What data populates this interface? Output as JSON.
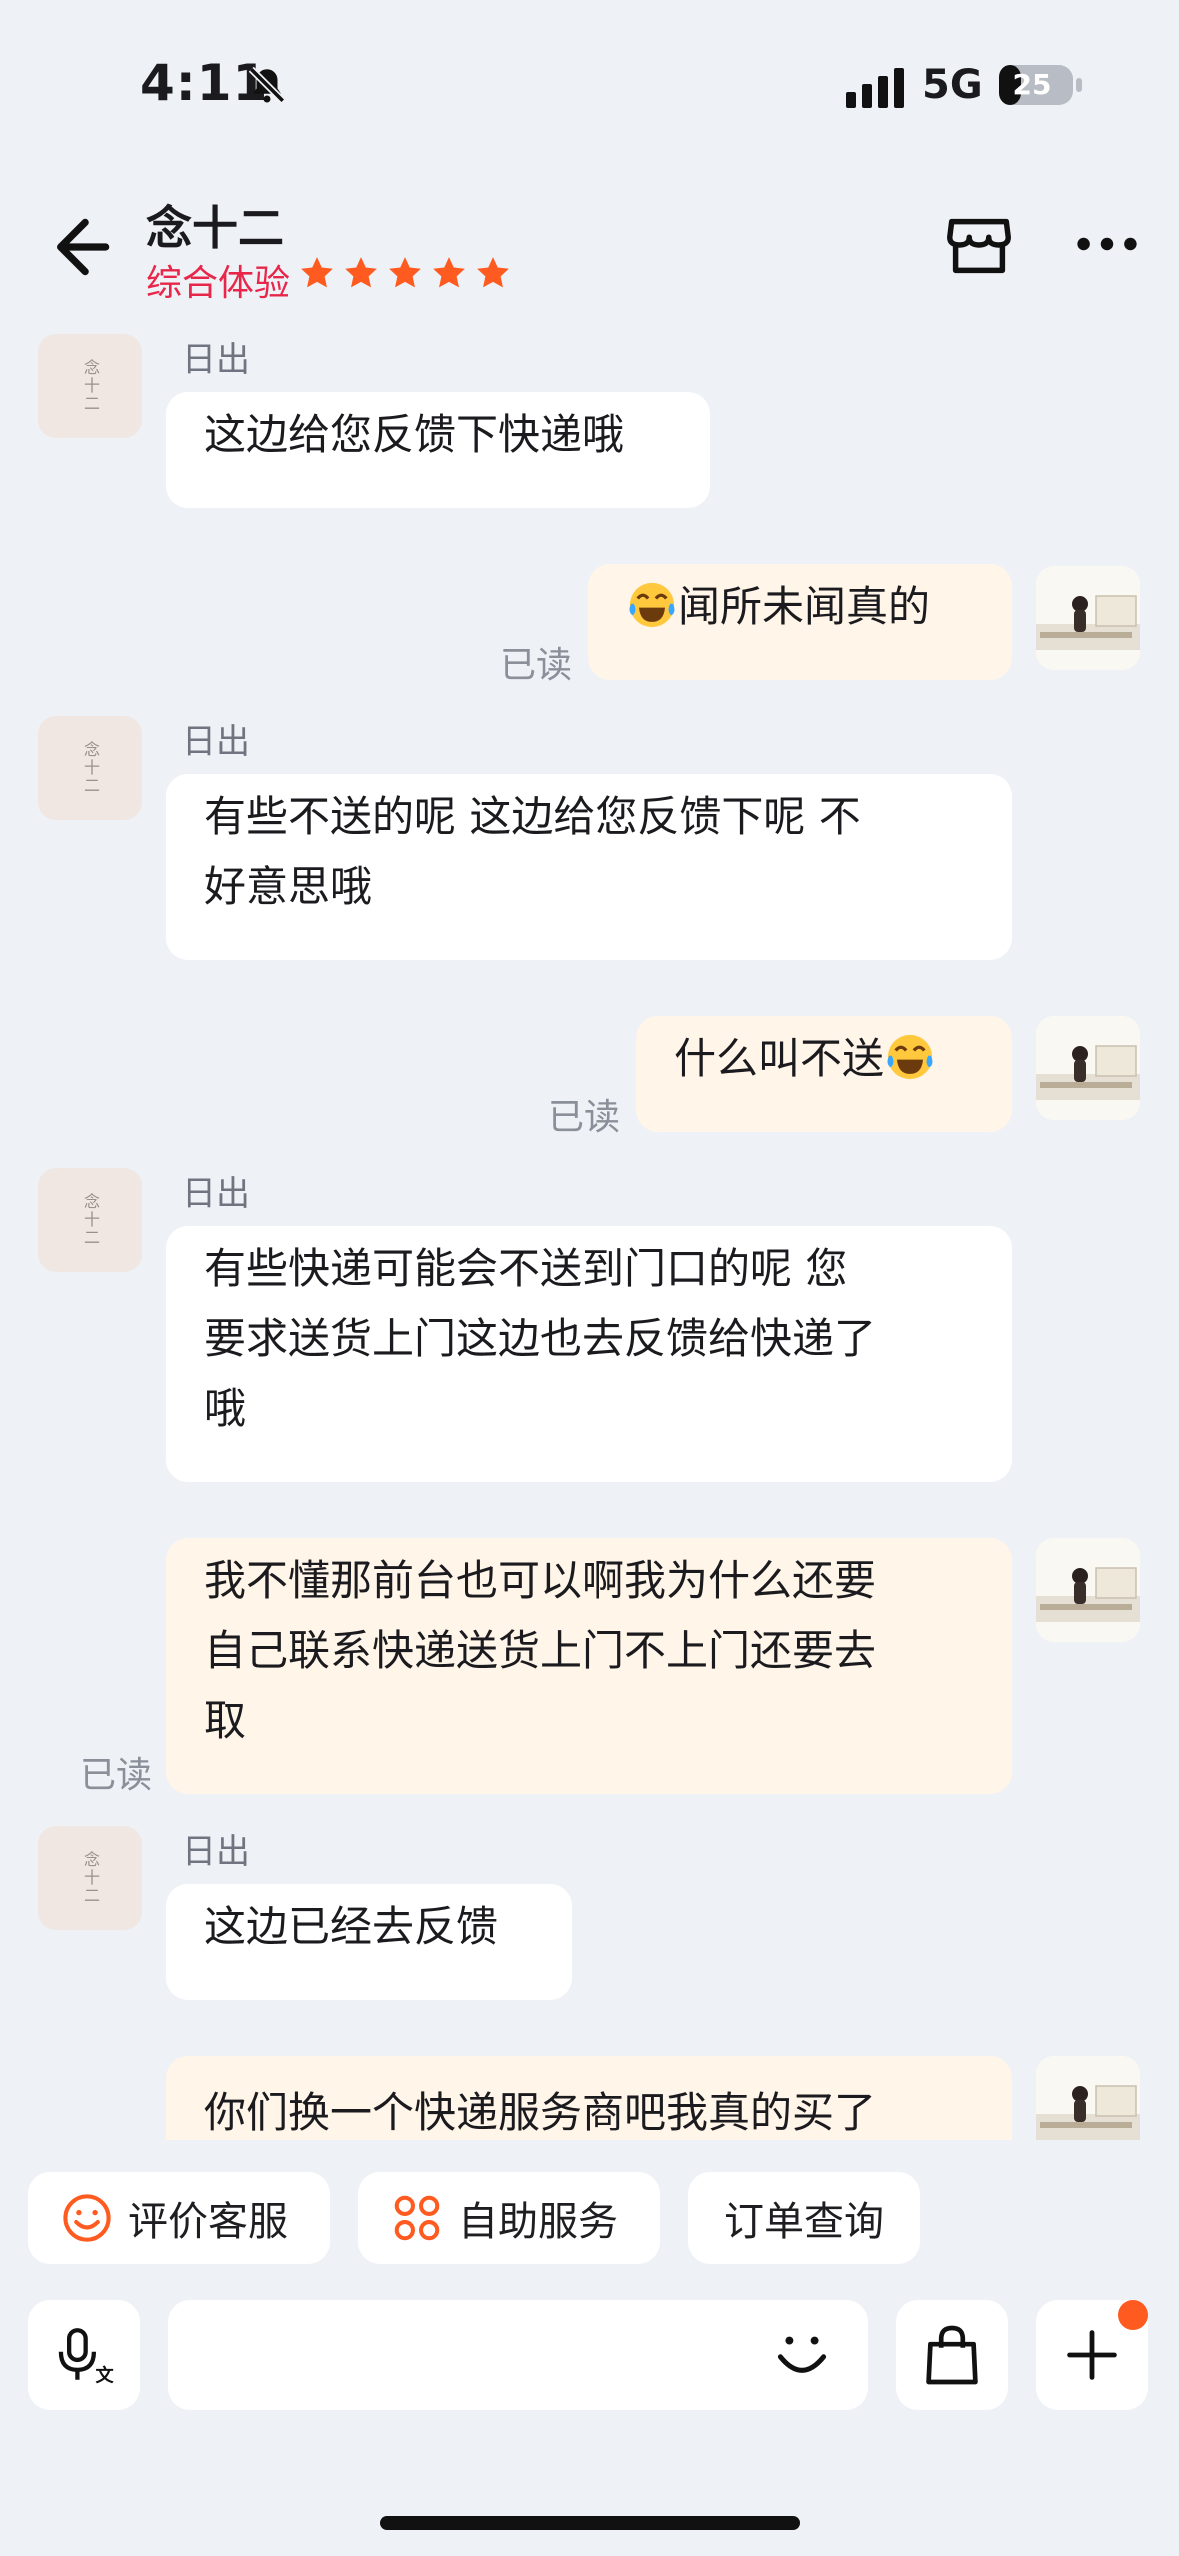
{
  "status_bar": {
    "time": "4:11",
    "network": "5G",
    "battery": "25"
  },
  "header": {
    "title": "念十二",
    "rating_label": "综合体验",
    "stars": 5
  },
  "avatar_text": "念十二",
  "messages": [
    {
      "side": "in",
      "sender": "日出",
      "lines": [
        "这边给您反馈下快递哦"
      ]
    },
    {
      "side": "out",
      "read": "已读",
      "text": "闻所未闻真的",
      "emoji": "😂",
      "emoji_position": "before"
    },
    {
      "side": "in",
      "sender": "日出",
      "lines": [
        "有些不送的呢 这边给您反馈下呢 不",
        "好意思哦"
      ]
    },
    {
      "side": "out",
      "read": "已读",
      "text": "什么叫不送",
      "emoji": "😂",
      "emoji_position": "after"
    },
    {
      "side": "in",
      "sender": "日出",
      "lines": [
        "有些快递可能会不送到门口的呢  您",
        "要求送货上门这边也去反馈给快递了",
        "哦"
      ]
    },
    {
      "side": "out",
      "read": "已读",
      "lines": [
        "我不懂那前台也可以啊我为什么还要",
        "自己联系快递送货上门不上门还要去",
        "取"
      ]
    },
    {
      "side": "in",
      "sender": "日出",
      "lines": [
        "这边已经去反馈"
      ]
    },
    {
      "side": "out",
      "lines": [
        "你们换一个快递服务商吧我真的买了"
      ]
    }
  ],
  "quick_actions": [
    {
      "label": "评价客服",
      "icon": "smiley-face-icon"
    },
    {
      "label": "自助服务",
      "icon": "grid-flower-icon"
    },
    {
      "label": "订单查询",
      "icon": ""
    }
  ],
  "colors": {
    "accent": "#ff5a1f",
    "rating": "#e8264a",
    "outgoing_bubble": "#fff5e8",
    "background": "#eef1f5"
  }
}
